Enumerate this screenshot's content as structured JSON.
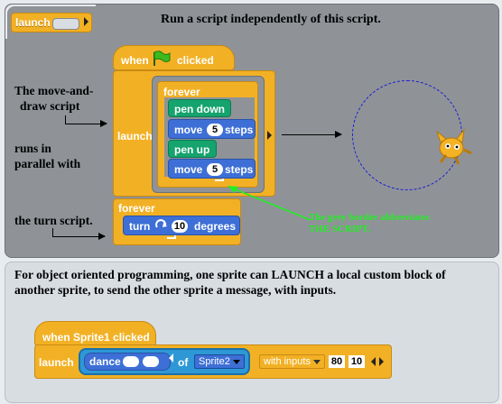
{
  "palette_block": {
    "label": "launch"
  },
  "heading": "Run a script independently of this script.",
  "annotations": {
    "move_and_draw_line1": "The move-and-",
    "move_and_draw_line2": "draw script",
    "runs_line1": "runs in",
    "runs_line2": "parallel with",
    "turn_script": "the turn script.",
    "grey_border_line1": "The grey border abbreviates",
    "grey_border_line2": "THE SCRIPT."
  },
  "script": {
    "hat_label": "when",
    "hat_suffix": "clicked",
    "launch_label": "launch",
    "forever_inner": "forever",
    "pen_down": "pen down",
    "move1_label": "move",
    "move1_value": "5",
    "move1_unit": "steps",
    "pen_up": "pen up",
    "move2_label": "move",
    "move2_value": "5",
    "move2_unit": "steps",
    "forever_outer": "forever",
    "turn_label": "turn",
    "turn_value": "10",
    "turn_unit": "degrees"
  },
  "description": "For object oriented programming, one sprite can LAUNCH a local custom block of another sprite, to send the other sprite a message, with inputs.",
  "example": {
    "hat_label": "when Sprite1 clicked",
    "launch_label": "launch",
    "dance_label": "dance",
    "of_label": "of",
    "sprite_select": "Sprite2",
    "with_inputs": "with inputs",
    "input1": "80",
    "input2": "10"
  },
  "colors": {
    "control": "#f2b125",
    "pen": "#15a36e",
    "motion": "#3d6fd6",
    "orbit": "#1a1ad6",
    "note": "#22ee22"
  },
  "icons": {
    "flag": "green-flag-icon",
    "turn": "turn-clockwise-icon",
    "loop": "loop-arrow-icon",
    "sprite": "sprite-icon"
  }
}
